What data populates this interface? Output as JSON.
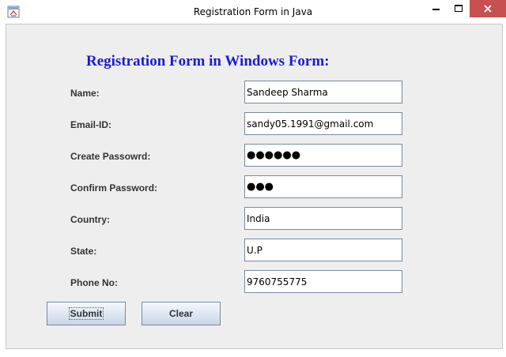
{
  "window": {
    "title": "Registration Form in Java"
  },
  "form": {
    "heading": "Registration Form in Windows Form:",
    "name_label": "Name:",
    "name_value": "Sandeep Sharma",
    "email_label": "Email-ID:",
    "email_value": "sandy05.1991@gmail.com",
    "create_password_label": "Create Passowrd:",
    "create_password_masked": "●●●●●●",
    "confirm_password_label": "Confirm Password:",
    "confirm_password_masked": "●●●",
    "country_label": "Country:",
    "country_value": "India",
    "state_label": "State:",
    "state_value": "U.P",
    "phone_label": "Phone No:",
    "phone_value": "9760755775"
  },
  "buttons": {
    "submit_label": "Submit",
    "clear_label": "Clear"
  },
  "icons": {
    "app": "java-window-icon",
    "minimize": "minimize-icon",
    "maximize": "maximize-icon",
    "close": "close-icon"
  },
  "colors": {
    "heading": "#1a1ad9",
    "close_button": "#c75050"
  }
}
